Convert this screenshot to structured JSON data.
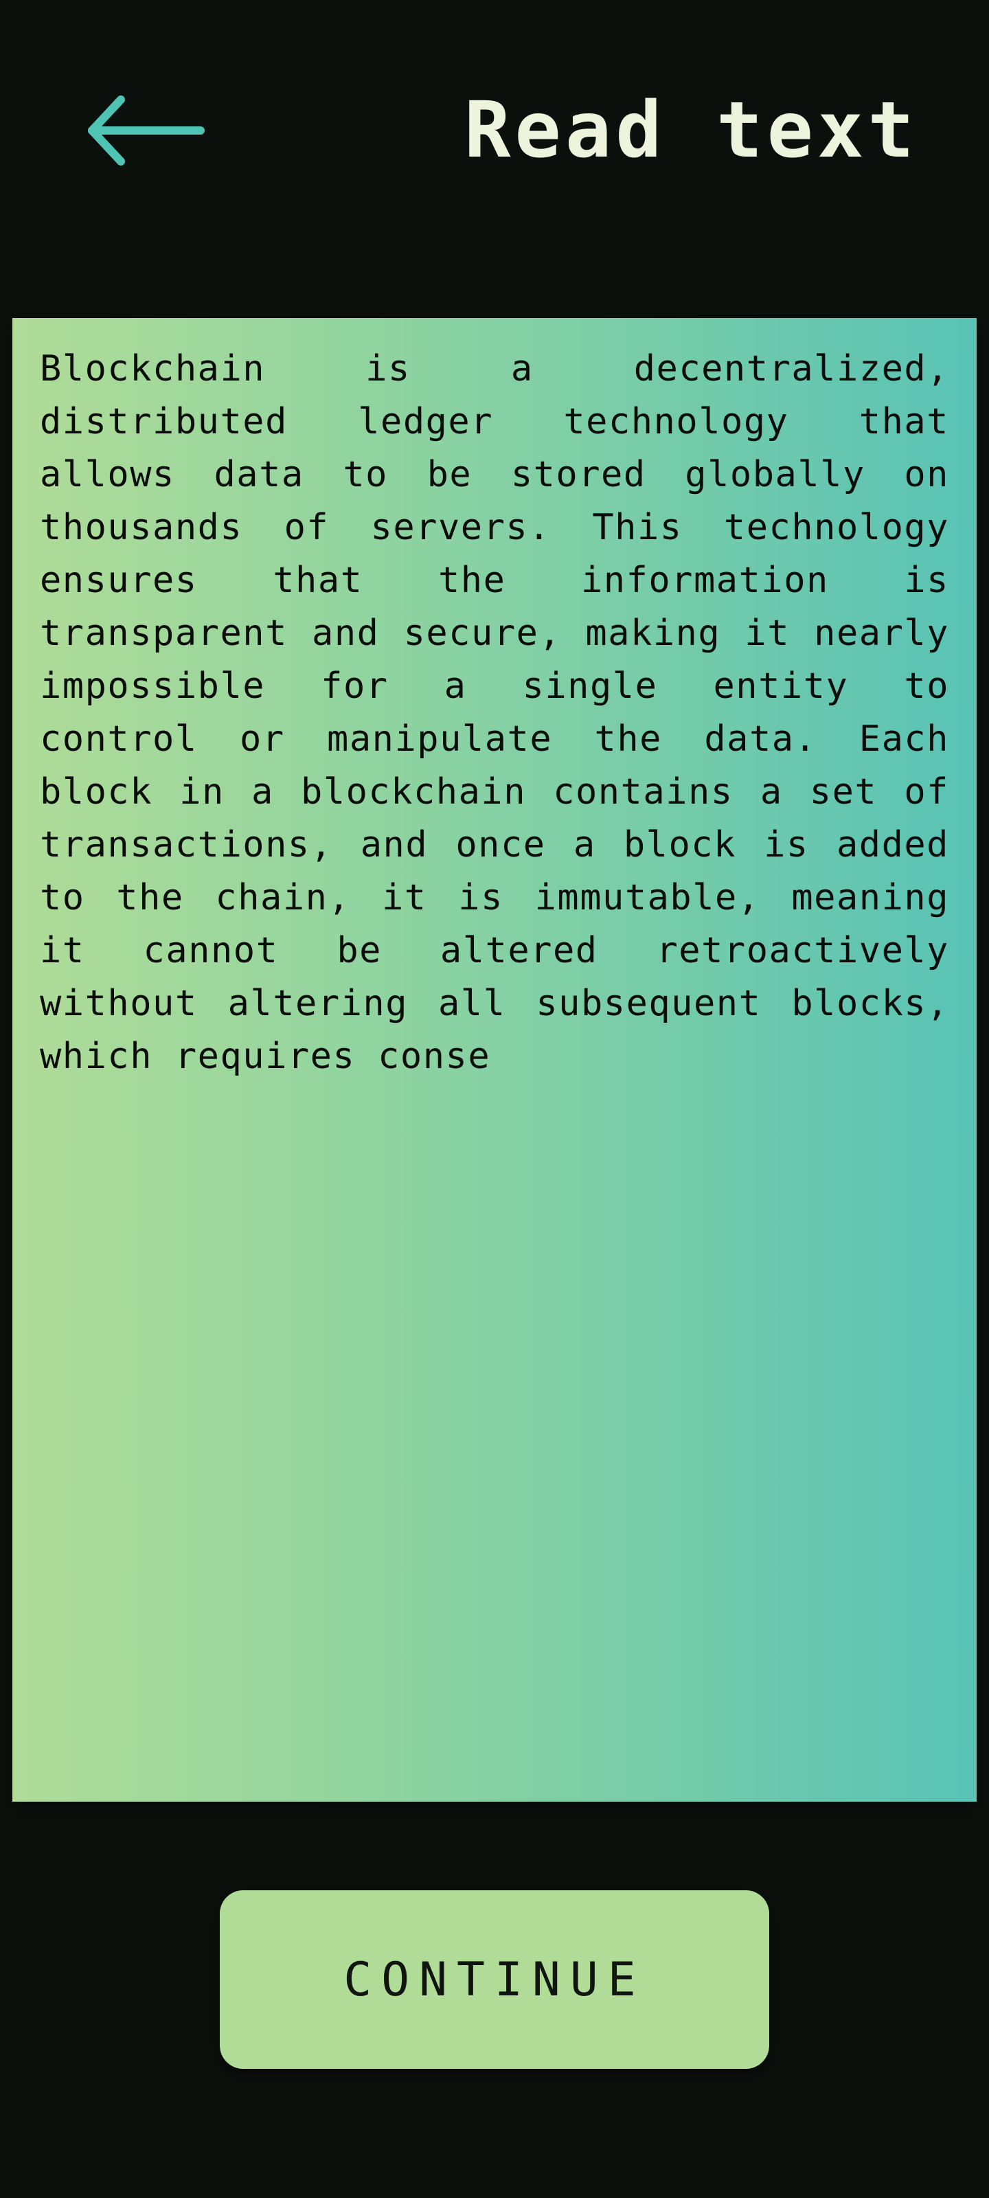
{
  "header": {
    "back_icon": "arrow-left-icon",
    "title": "Read text"
  },
  "content": {
    "text": "Blockchain is a decentralized, distributed ledger technology that allows data to be stored globally on thousands of servers. This technology ensures that the information is transparent and secure, making it nearly impossible for a single entity to control or manipulate the data. Each block in a blockchain contains a set of transactions, and once a block is added to the chain, it is immutable, meaning it cannot be altered retroactively without altering all subsequent blocks, which requires conse"
  },
  "footer": {
    "continue_label": "CONTINUE"
  },
  "colors": {
    "background": "#0c100d",
    "accent_teal": "#4fc3b4",
    "accent_green": "#b0dc98",
    "title_text": "#eef3de"
  }
}
